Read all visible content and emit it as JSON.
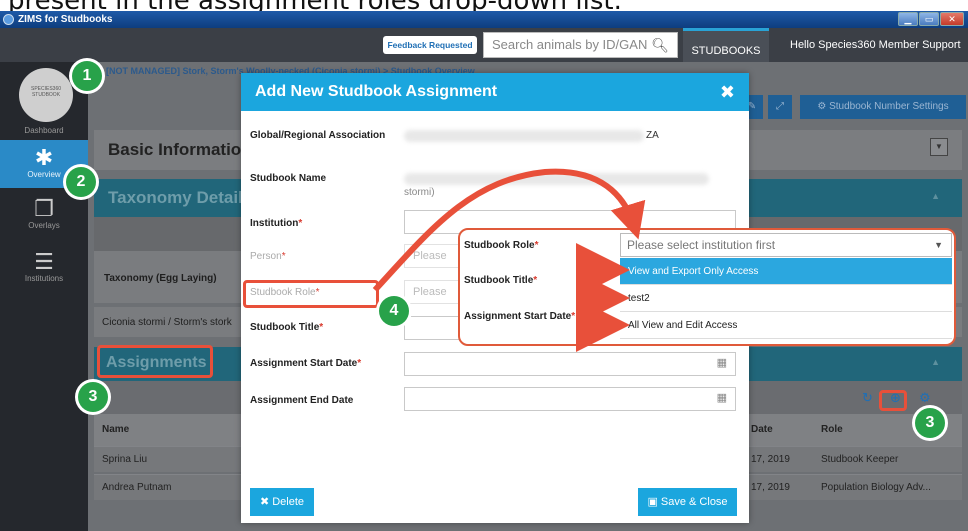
{
  "caption": "present in the assignment roles drop-down list.",
  "window": {
    "title": "ZIMS for Studbooks",
    "buttons": [
      "▁",
      "▭",
      "✕"
    ]
  },
  "topnav": {
    "feedback_label": "Feedback Requested",
    "search_placeholder": "Search animals by ID/GAN",
    "tab_label": "STUDBOOKS",
    "greeting": "Hello Species360 Member Support"
  },
  "sidebar": {
    "avatar_text": "SPECIES360 STUDBOOK",
    "items": [
      {
        "label": "Dashboard",
        "icon": "dashboard-icon"
      },
      {
        "label": "Overview",
        "icon": "asterisk-icon"
      },
      {
        "label": "Overlays",
        "icon": "overlays-icon"
      },
      {
        "label": "Institutions",
        "icon": "list-icon"
      }
    ]
  },
  "main": {
    "breadcrumb": "[NOT MANAGED] Stork, Storm's Woolly-necked (Ciconia stormi) > Studbook Overview",
    "toolbar_btn": "Studbook Number Settings",
    "basic_info_title": "Basic Information",
    "taxonomy_title": "Taxonomy Details",
    "taxonomy_label": "Taxonomy (Egg Laying)",
    "taxonomy_value": "Ciconia stormi / Storm's stork",
    "assignments_title": "Assignments",
    "table": {
      "columns": [
        "Name",
        "Date",
        "Role"
      ],
      "rows": [
        {
          "name": "Sprina Liu",
          "date": "17, 2019",
          "role": "Studbook Keeper"
        },
        {
          "name": "Andrea Putnam",
          "date": "17, 2019",
          "role": "Population Biology Adv..."
        }
      ]
    }
  },
  "modal": {
    "title": "Add New Studbook Assignment",
    "close": "✖",
    "fields": {
      "association_label": "Global/Regional Association",
      "association_value": "ZA",
      "studbook_name_label": "Studbook Name",
      "studbook_name_value": "stormi)",
      "institution_label": "Institution",
      "person_label": "Person",
      "person_placeholder": "Please",
      "role_label": "Studbook Role",
      "role_placeholder": "Please",
      "title_label": "Studbook Title",
      "start_label": "Assignment Start Date",
      "end_label": "Assignment End Date",
      "required_mark": "*"
    },
    "delete_label": "Delete",
    "save_label": "Save & Close"
  },
  "popup": {
    "role_label": "Studbook Role",
    "role_placeholder": "Please select institution first",
    "title_label": "Studbook Title",
    "start_label": "Assignment Start Date",
    "options": [
      "View and Export Only Access",
      "test2",
      "All View and Edit Access"
    ]
  },
  "callouts": [
    "1",
    "2",
    "3",
    "3",
    "4"
  ]
}
